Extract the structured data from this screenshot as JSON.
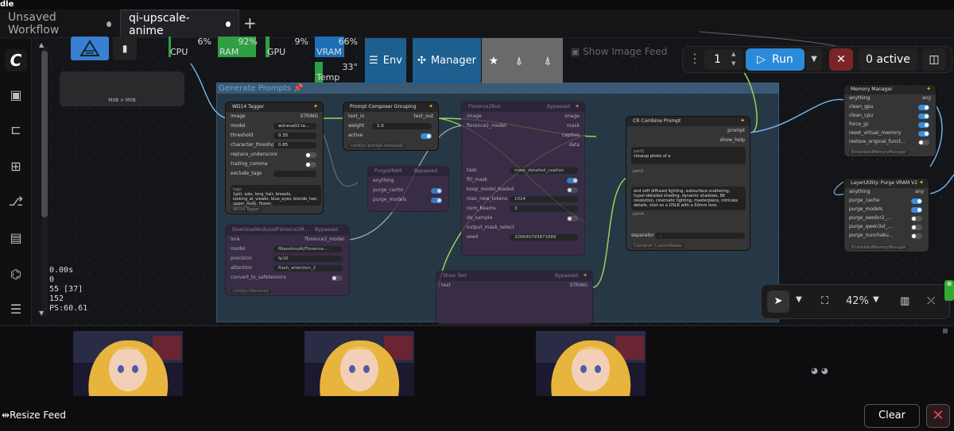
{
  "window": {
    "title_fragment": "dle"
  },
  "tabs": [
    {
      "label": "Unsaved Workflow",
      "active": false
    },
    {
      "label": "qi-upscale-anime",
      "active": true
    }
  ],
  "tab_add": "+",
  "resources": {
    "cpu": {
      "label": "CPU",
      "value": "6%",
      "fraction": 0.06
    },
    "ram": {
      "label": "RAM",
      "value": "92%",
      "fraction": 0.92
    },
    "gpu": {
      "label": "GPU",
      "value": "9%",
      "fraction": 0.09
    },
    "vram": {
      "label": "VRAM",
      "value": "66%",
      "fraction": 0.66
    },
    "temp": {
      "label": "Temp",
      "value": "33°"
    }
  },
  "toolbar": {
    "env_label": "Env",
    "manager_label": "Manager",
    "show_feed_label": "Show Image Feed",
    "queue_count": "1",
    "run_label": "Run",
    "active_label": "0 active",
    "thumb_caption": "M08 × M08"
  },
  "group": {
    "title": "Generate Prompts"
  },
  "nodes": {
    "wd14": {
      "title": "WD14 Tagger",
      "input": "image",
      "output": "STRING",
      "model_label": "model",
      "model_value": "wd-eva02-la...",
      "threshold_label": "threshold",
      "threshold_value": "0.35",
      "char_threshold_label": "character_threshold",
      "char_threshold_value": "0.85",
      "replace_underscore_label": "replace_underscore",
      "trailing_comma_label": "trailing_comma",
      "exclude_tags_label": "exclude_tags",
      "tags_label": "tags",
      "tags_text": "1girl, solo, long_hair, breasts, looking_at_viewer, blue_eyes, blonde_hair, upper_body, flower,",
      "tag": "WD14 Tagger"
    },
    "composer": {
      "title": "Prompt Composer Grouping",
      "input": "text_in",
      "output": "text_out",
      "weight_label": "weight",
      "weight_value": "1.0",
      "active_label": "active",
      "tag": "comfyui-prompt-composer"
    },
    "florence_run": {
      "title": "Florence2Run",
      "bypass": "Bypassed",
      "in1": "image",
      "in2": "florence2_model",
      "out1": "image",
      "out2": "mask",
      "out3": "caption",
      "out4": "data",
      "task_label": "task",
      "task_value": "more_detailed_caption",
      "fill_mask_label": "fill_mask",
      "keep_model_label": "keep_model_loaded",
      "max_tokens_label": "max_new_tokens",
      "max_tokens_value": "1024",
      "num_beams_label": "num_beams",
      "num_beams_value": "3",
      "do_sample_label": "do_sample",
      "output_mask_label": "output_mask_select",
      "seed_label": "seed",
      "seed_value": "328640793871689"
    },
    "purge": {
      "title": "PurgeVRAM",
      "bypass": "Bypassed",
      "in": "anything",
      "purge_cache": "purge_cache",
      "purge_models": "purge_models"
    },
    "download": {
      "title": "DownloadAndLoadFlorence2M...",
      "bypass": "Bypassed",
      "in": "lora",
      "out": "florence2_model",
      "model_label": "model",
      "model_value": "MiaoshouAI/Florence-...",
      "precision_label": "precision",
      "precision_value": "fp16",
      "attention_label": "attention",
      "attention_value": "flash_attention_2",
      "convert_label": "convert_to_safetensors",
      "tag": "comfyui-florence2"
    },
    "show_text": {
      "title": "Show Text",
      "bypass": "Bypassed",
      "in": "text",
      "out": "STRING"
    },
    "combine": {
      "title": "CR Combine Prompt",
      "out1": "prompt",
      "out2": "show_help",
      "part1_label": "part1",
      "part1_text": "closeup photo of a",
      "part2_label": "part2",
      "part3_text": "and soft diffused lighting, subsurface scattering, hyper-detailed shading, dynamic shadows, 8K resolution, cinematic lighting, masterpiece, intricate details, shot on a DSLR with a 50mm lens.",
      "part4_label": "part4",
      "separator_label": "separator",
      "separator_value": ",",
      "tag": "Comfyroll_CustomNodes"
    },
    "memory_manager": {
      "title": "Memory Manager",
      "in": "anything",
      "out": "any",
      "rows": [
        "clean_gpu",
        "clean_cpu",
        "force_gc",
        "reset_virtual_memory",
        "restore_original_funct..."
      ],
      "tag": "EmbeddedMemoryManager"
    },
    "purge_v2": {
      "title": "LayerUtility: Purge VRAM V2",
      "in": "anything",
      "out": "any",
      "rows": [
        "purge_cache",
        "purge_models",
        "purge_seedvr2_...",
        "purge_qwen3vl_...",
        "purge_nunchaku..."
      ],
      "tag": "EmbeddedMemoryManager"
    }
  },
  "stats": {
    "line1": "0.00s",
    "line2": "0",
    "line3": "55 [37]",
    "line4": "152",
    "line5": "PS:60.61"
  },
  "zoom": {
    "level": "42%"
  },
  "feed": {
    "resize_label": "Resize Feed",
    "clear_label": "Clear"
  },
  "colors": {
    "accent": "#2b8bd8",
    "manager_bg": "#1d5f8e",
    "stop_bg": "#7b2428",
    "group_bg": "#35546e",
    "link_green": "#9bd35a",
    "link_blue": "#6fb0e6",
    "node_purple": "#3e2a46"
  }
}
